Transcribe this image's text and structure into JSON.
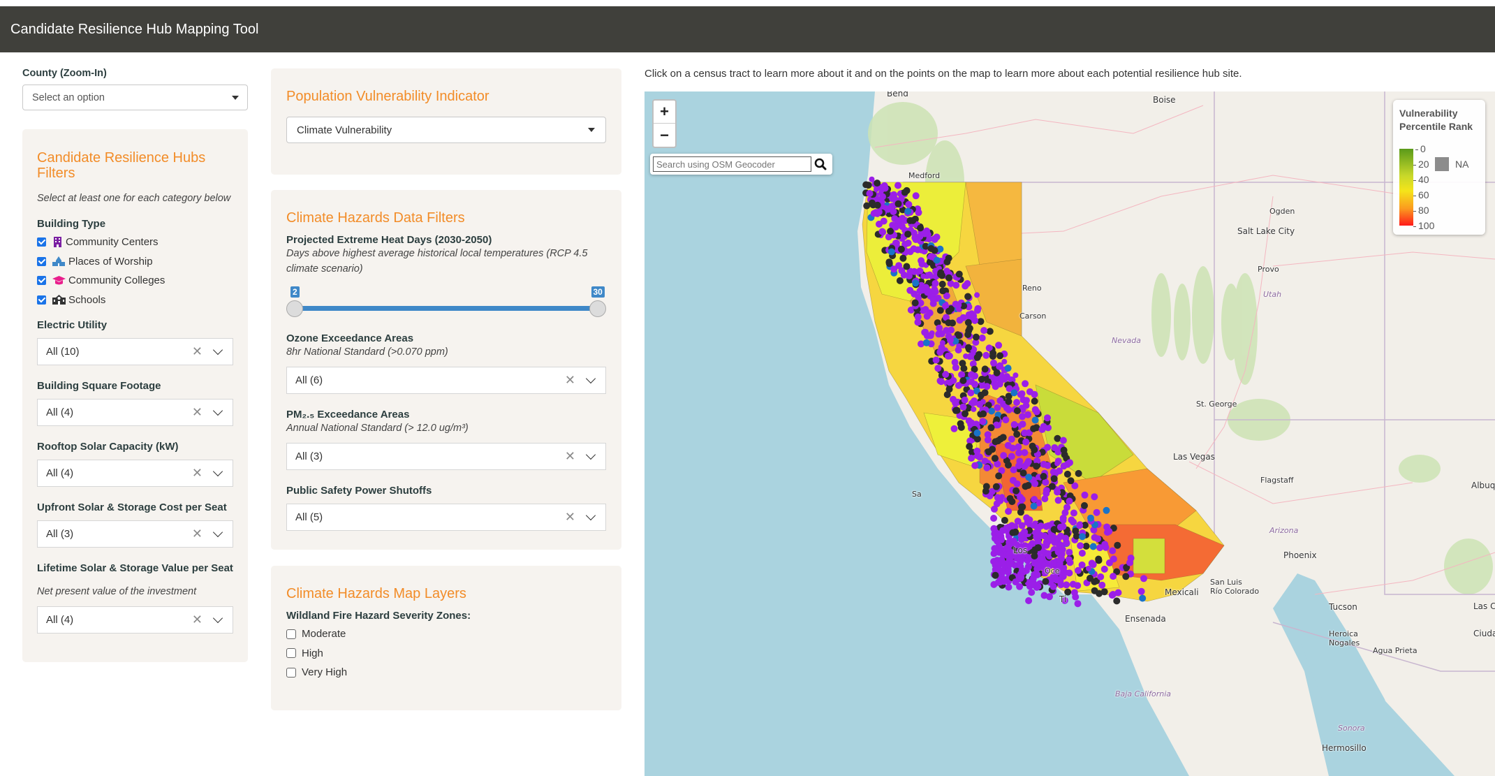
{
  "header": {
    "title": "Candidate Resilience Hub Mapping Tool"
  },
  "county": {
    "label": "County (Zoom-In)",
    "placeholder": "Select an option"
  },
  "hub_filters": {
    "title": "Candidate Resilience Hubs Filters",
    "note": "Select at least one for each category below",
    "building_type": {
      "label": "Building Type",
      "options": [
        {
          "label": "Community Centers",
          "checked": true,
          "icon": "building-icon",
          "icon_color": "#7b1fa2"
        },
        {
          "label": "Places of Worship",
          "checked": true,
          "icon": "church-icon",
          "icon_color": "#3f88c8"
        },
        {
          "label": "Community Colleges",
          "checked": true,
          "icon": "graduation-cap-icon",
          "icon_color": "#e91e8c"
        },
        {
          "label": "Schools",
          "checked": true,
          "icon": "school-icon",
          "icon_color": "#333333"
        }
      ]
    },
    "electric_utility": {
      "label": "Electric Utility",
      "value": "All (10)"
    },
    "building_sqft": {
      "label": "Building Square Footage",
      "value": "All (4)"
    },
    "rooftop_solar": {
      "label": "Rooftop Solar Capacity (kW)",
      "value": "All (4)"
    },
    "upfront_cost": {
      "label": "Upfront Solar & Storage Cost per Seat",
      "value": "All (3)"
    },
    "lifetime_value": {
      "label": "Lifetime Solar & Storage Value per Seat",
      "note": "Net present value of the investment",
      "value": "All (4)"
    }
  },
  "vulnerability": {
    "title": "Population Vulnerability Indicator",
    "selected": "Climate Vulnerability"
  },
  "hazard_filters": {
    "title": "Climate Hazards Data Filters",
    "heat_days": {
      "label": "Projected Extreme Heat Days (2030-2050)",
      "note": "Days above highest average historical local temperatures (RCP 4.5 climate scenario)",
      "min": 2,
      "max": 30,
      "low": 2,
      "high": 30,
      "low_label": "2",
      "high_label": "30"
    },
    "ozone": {
      "label": "Ozone Exceedance Areas",
      "note": "8hr National Standard (>0.070 ppm)",
      "value": "All (6)"
    },
    "pm25": {
      "label": "PM₂.₅ Exceedance Areas",
      "note": "Annual National Standard (> 12.0 ug/m³)",
      "value": "All (3)"
    },
    "psps": {
      "label": "Public Safety Power Shutoffs",
      "value": "All (5)"
    }
  },
  "map_layers": {
    "title": "Climate Hazards Map Layers",
    "fire_label": "Wildland Fire Hazard Severity Zones:",
    "fire_options": [
      {
        "label": "Moderate",
        "checked": false
      },
      {
        "label": "High",
        "checked": false
      },
      {
        "label": "Very High",
        "checked": false
      }
    ]
  },
  "map": {
    "instruction": "Click on a census tract to learn more about it and on the points on the map to learn more about each potential resilience hub site.",
    "zoom_in": "+",
    "zoom_out": "−",
    "geocoder_placeholder": "Search using OSM Geocoder",
    "legend": {
      "title": "Vulnerability Percentile Rank",
      "ticks": [
        "0",
        "20",
        "40",
        "60",
        "80",
        "100"
      ],
      "na_label": "NA",
      "na_color": "#8c8c8c",
      "gradient": [
        "#5a9a1a",
        "#f5e41a",
        "#fb9a1f",
        "#ff1a1a"
      ]
    },
    "point_colors": {
      "community_centers": "#9b1fe8",
      "schools": "#2b2b2b",
      "places_of_worship": "#1a73c8"
    },
    "labels": {
      "bend": "Bend",
      "boise": "Boise",
      "medford": "Medford",
      "ogden": "Ogden",
      "salt_lake_city": "Salt Lake City",
      "provo": "Provo",
      "utah": "Utah",
      "nevada": "Nevada",
      "reno": "Reno",
      "carson": "Carson",
      "st_george": "St. George",
      "las_vegas": "Las Vegas",
      "flagstaff": "Flagstaff",
      "albuquerque": "Albuqu",
      "arizona": "Arizona",
      "phoenix": "Phoenix",
      "tucson": "Tucson",
      "mexicali": "Mexicali",
      "san_luis": "San Luis",
      "rio_colorado": "Río Colorado",
      "ensenada": "Ensenada",
      "heroica": "Heroica",
      "nogales": "Nogales",
      "agua_prieta": "Agua Prieta",
      "las_cruces": "Las Cru",
      "ciudad": "Ciuda",
      "baja_california": "Baja California",
      "sonora": "Sonora",
      "hermosillo": "Hermosillo",
      "los": "Los",
      "oce": "Oce",
      "ti": "Ti",
      "sa": "Sa"
    }
  }
}
